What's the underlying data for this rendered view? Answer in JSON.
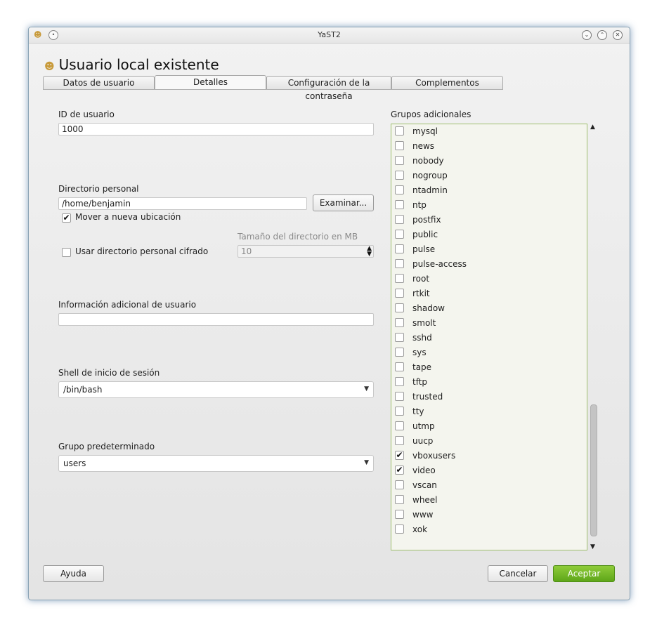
{
  "window": {
    "title": "YaST2"
  },
  "heading": "Usuario local existente",
  "tabs": [
    {
      "label": "Datos de usuario",
      "active": false
    },
    {
      "label": "Detalles",
      "active": true
    },
    {
      "label": "Configuración de la contraseña",
      "active": false
    },
    {
      "label": "Complementos",
      "active": false
    }
  ],
  "form": {
    "user_id_label": "ID de usuario",
    "user_id_value": "1000",
    "home_label": "Directorio personal",
    "home_value": "/home/benjamin",
    "browse_label": "Examinar...",
    "move_label": "Mover a nueva ubicación",
    "move_checked": true,
    "encrypted_label": "Usar directorio personal cifrado",
    "encrypted_checked": false,
    "dir_size_label": "Tamaño del directorio en MB",
    "dir_size_value": "10",
    "info_label": "Información adicional de usuario",
    "info_value": "",
    "shell_label": "Shell de inicio de sesión",
    "shell_value": "/bin/bash",
    "group_label": "Grupo predeterminado",
    "group_value": "users"
  },
  "groups": {
    "label": "Grupos adicionales",
    "items": [
      {
        "name": "mysql",
        "checked": false
      },
      {
        "name": "news",
        "checked": false
      },
      {
        "name": "nobody",
        "checked": false
      },
      {
        "name": "nogroup",
        "checked": false
      },
      {
        "name": "ntadmin",
        "checked": false
      },
      {
        "name": "ntp",
        "checked": false
      },
      {
        "name": "postfix",
        "checked": false
      },
      {
        "name": "public",
        "checked": false
      },
      {
        "name": "pulse",
        "checked": false
      },
      {
        "name": "pulse-access",
        "checked": false
      },
      {
        "name": "root",
        "checked": false
      },
      {
        "name": "rtkit",
        "checked": false
      },
      {
        "name": "shadow",
        "checked": false
      },
      {
        "name": "smolt",
        "checked": false
      },
      {
        "name": "sshd",
        "checked": false
      },
      {
        "name": "sys",
        "checked": false
      },
      {
        "name": "tape",
        "checked": false
      },
      {
        "name": "tftp",
        "checked": false
      },
      {
        "name": "trusted",
        "checked": false
      },
      {
        "name": "tty",
        "checked": false
      },
      {
        "name": "utmp",
        "checked": false
      },
      {
        "name": "uucp",
        "checked": false
      },
      {
        "name": "vboxusers",
        "checked": true
      },
      {
        "name": "video",
        "checked": true
      },
      {
        "name": "vscan",
        "checked": false
      },
      {
        "name": "wheel",
        "checked": false
      },
      {
        "name": "www",
        "checked": false
      },
      {
        "name": "xok",
        "checked": false
      }
    ]
  },
  "buttons": {
    "help": "Ayuda",
    "cancel": "Cancelar",
    "accept": "Aceptar"
  },
  "colors": {
    "accent_green": "#6cb422",
    "list_border": "#9fbf6e"
  },
  "icons": {
    "window_icon": "users-icon",
    "heading_icon": "users-icon"
  }
}
